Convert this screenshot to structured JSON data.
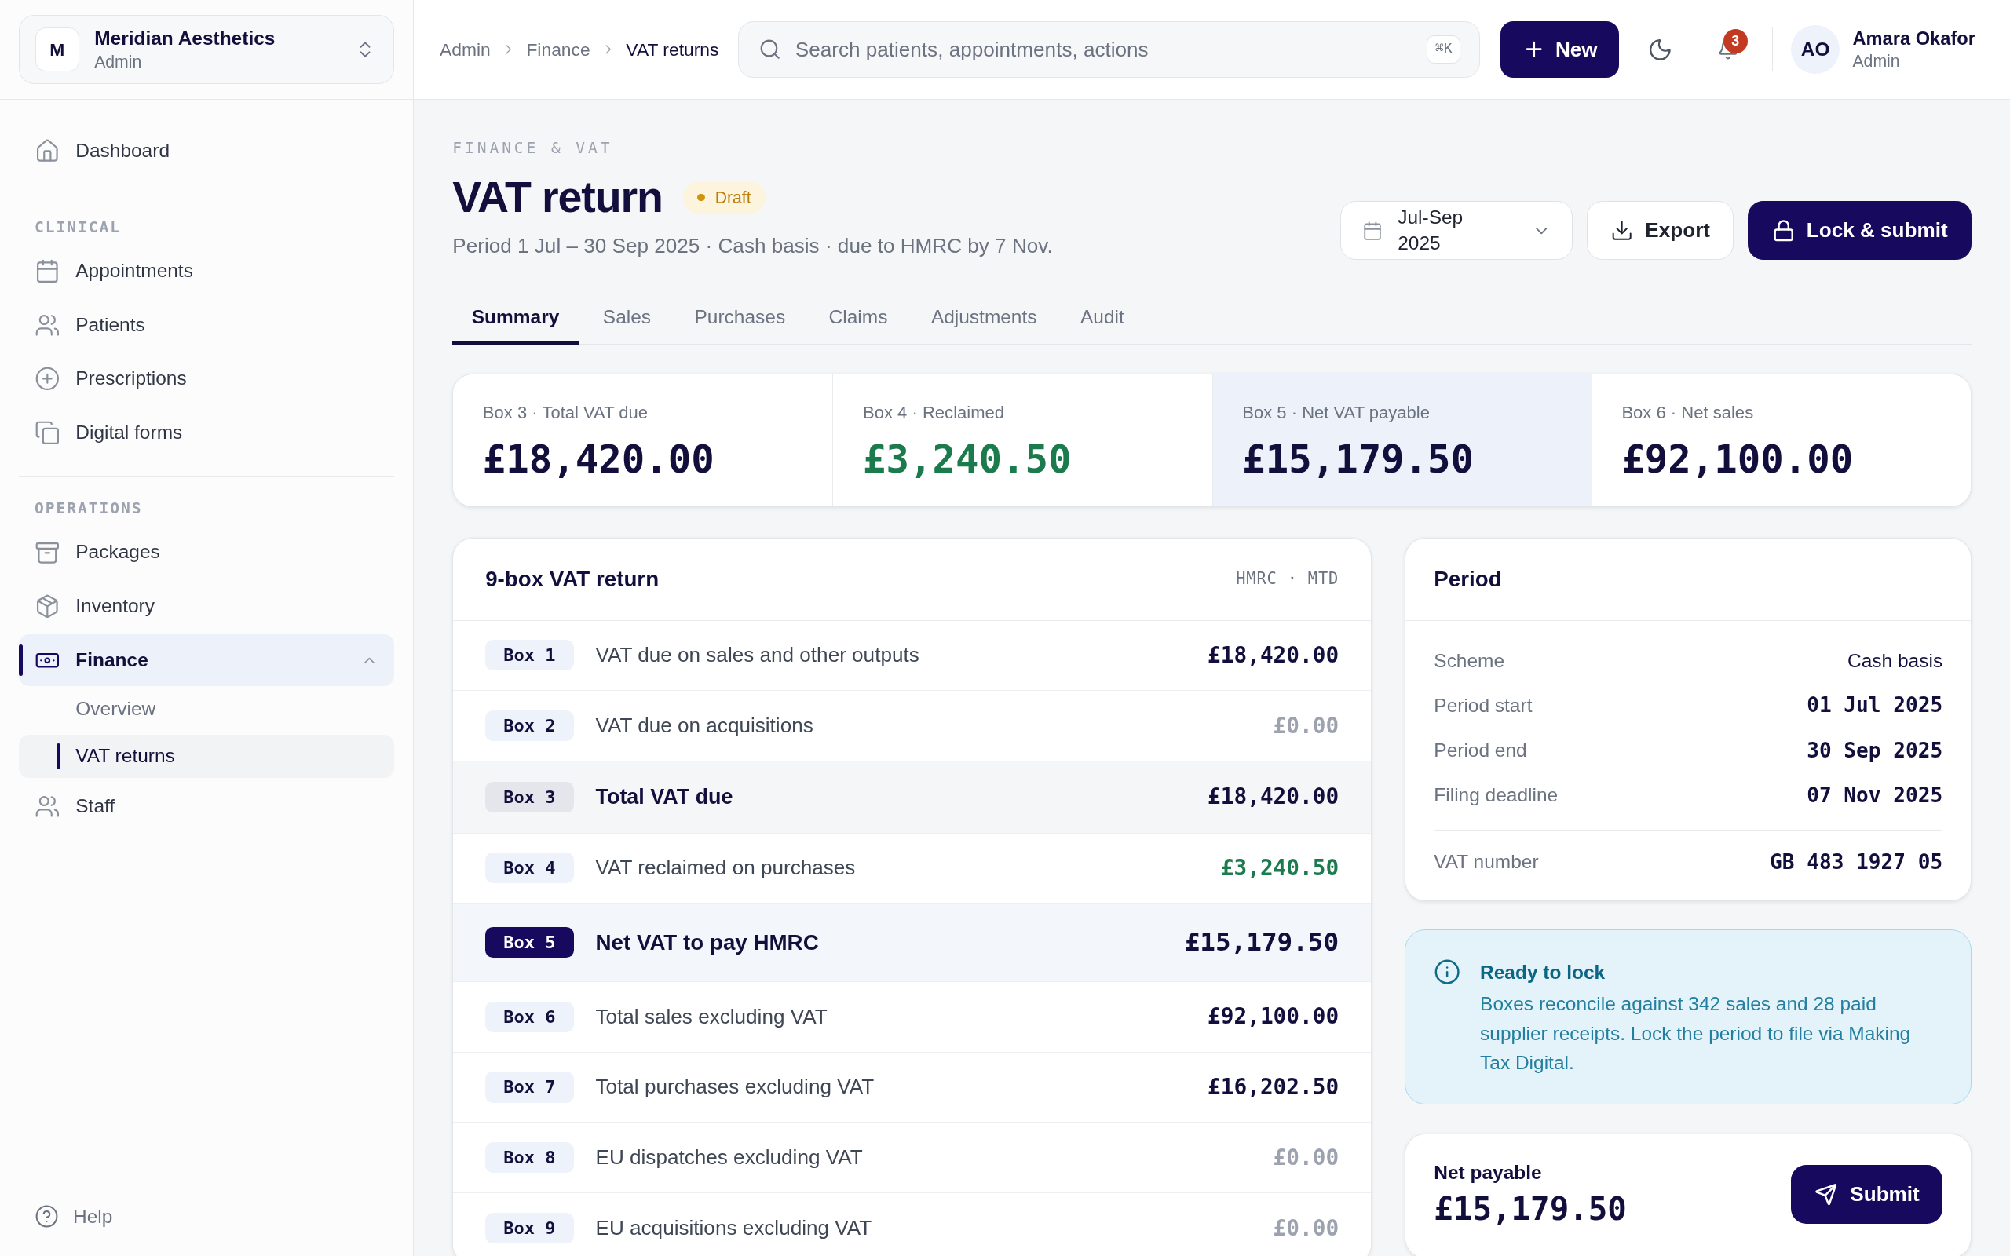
{
  "sidebar": {
    "workspace": {
      "initial": "M",
      "name": "Meridian Aesthetics",
      "role": "Admin"
    },
    "sections": [
      {
        "items": [
          {
            "label": "Dashboard",
            "selected": false
          }
        ]
      },
      {
        "title": "CLINICAL",
        "items": [
          {
            "label": "Appointments",
            "selected": false
          },
          {
            "label": "Patients",
            "selected": false
          },
          {
            "label": "Prescriptions",
            "selected": false
          },
          {
            "label": "Digital forms",
            "selected": false
          }
        ]
      },
      {
        "title": "OPERATIONS",
        "items": [
          {
            "label": "Packages",
            "selected": false
          },
          {
            "label": "Inventory",
            "selected": false
          },
          {
            "label": "Finance",
            "selected": true,
            "expanded": true,
            "children": [
              {
                "label": "Overview",
                "selected": false
              },
              {
                "label": "VAT returns",
                "selected": true
              }
            ]
          },
          {
            "label": "Staff",
            "selected": false
          }
        ]
      }
    ],
    "footer": {
      "label": "Help"
    }
  },
  "topbar": {
    "breadcrumb": [
      {
        "label": "Admin",
        "current": false
      },
      {
        "label": "Finance",
        "current": false
      },
      {
        "label": "VAT returns",
        "current": true
      }
    ],
    "search": {
      "placeholder": "Search patients, appointments, actions",
      "shortcut": "⌘K"
    },
    "new_button": {
      "label": "New"
    },
    "notifications": {
      "count": "3"
    },
    "user": {
      "initials": "AO",
      "name": "Amara Okafor",
      "role": "Admin"
    }
  },
  "page": {
    "eyebrow": "FINANCE & VAT",
    "title": "VAT return",
    "status": {
      "label": "Draft"
    },
    "subtitle": "Period 1 Jul – 30 Sep 2025 · Cash basis · due to HMRC by 7 Nov.",
    "period_select": {
      "value": "Jul-Sep 2025"
    },
    "actions": [
      {
        "label": "Export",
        "kind": "secondary"
      },
      {
        "label": "Lock & submit",
        "kind": "primary"
      }
    ]
  },
  "tabs": [
    {
      "label": "Summary",
      "selected": true
    },
    {
      "label": "Sales",
      "selected": false
    },
    {
      "label": "Purchases",
      "selected": false
    },
    {
      "label": "Claims",
      "selected": false
    },
    {
      "label": "Adjustments",
      "selected": false
    },
    {
      "label": "Audit",
      "selected": false
    }
  ],
  "summary_cards": [
    {
      "label": "Box 3 · Total VAT due",
      "value": "£18,420.00",
      "kind": "standard",
      "highlighted": false
    },
    {
      "label": "Box 4 · Reclaimed",
      "value": "£3,240.50",
      "kind": "credit",
      "highlighted": false
    },
    {
      "label": "Box 5 · Net VAT payable",
      "value": "£15,179.50",
      "kind": "standard",
      "highlighted": true
    },
    {
      "label": "Box 6 · Net sales",
      "value": "£92,100.00",
      "kind": "standard",
      "highlighted": false
    }
  ],
  "vat_return": {
    "title": "9-box VAT return",
    "meta": "HMRC · MTD",
    "rows": [
      {
        "box": "Box 1",
        "description": "VAT due on sales and other outputs",
        "amount": "£18,420.00",
        "kind": "line"
      },
      {
        "box": "Box 2",
        "description": "VAT due on acquisitions",
        "amount": "£0.00",
        "kind": "zero"
      },
      {
        "box": "Box 3",
        "description": "Total VAT due",
        "amount": "£18,420.00",
        "kind": "subtotal"
      },
      {
        "box": "Box 4",
        "description": "VAT reclaimed on purchases",
        "amount": "£3,240.50",
        "kind": "credit"
      },
      {
        "box": "Box 5",
        "description": "Net VAT to pay HMRC",
        "amount": "£15,179.50",
        "kind": "total"
      },
      {
        "box": "Box 6",
        "description": "Total sales excluding VAT",
        "amount": "£92,100.00",
        "kind": "line"
      },
      {
        "box": "Box 7",
        "description": "Total purchases excluding VAT",
        "amount": "£16,202.50",
        "kind": "line"
      },
      {
        "box": "Box 8",
        "description": "EU dispatches excluding VAT",
        "amount": "£0.00",
        "kind": "zero"
      },
      {
        "box": "Box 9",
        "description": "EU acquisitions excluding VAT",
        "amount": "£0.00",
        "kind": "zero"
      }
    ]
  },
  "period": {
    "title": "Period",
    "details": [
      {
        "label": "Scheme",
        "value": "Cash basis",
        "kind": "text"
      },
      {
        "label": "Period start",
        "value": "01 Jul 2025",
        "kind": "date"
      },
      {
        "label": "Period end",
        "value": "30 Sep 2025",
        "kind": "date"
      },
      {
        "label": "Filing deadline",
        "value": "07 Nov 2025",
        "kind": "date"
      }
    ],
    "registration": {
      "label": "VAT number",
      "value": "GB 483 1927 05"
    }
  },
  "callout": {
    "title": "Ready to lock",
    "body": "Boxes reconcile against 342 sales and 28 paid supplier receipts. Lock the period to file via Making Tax Digital."
  },
  "net_payable": {
    "label": "Net payable",
    "amount": "£15,179.50",
    "button": "Submit"
  }
}
